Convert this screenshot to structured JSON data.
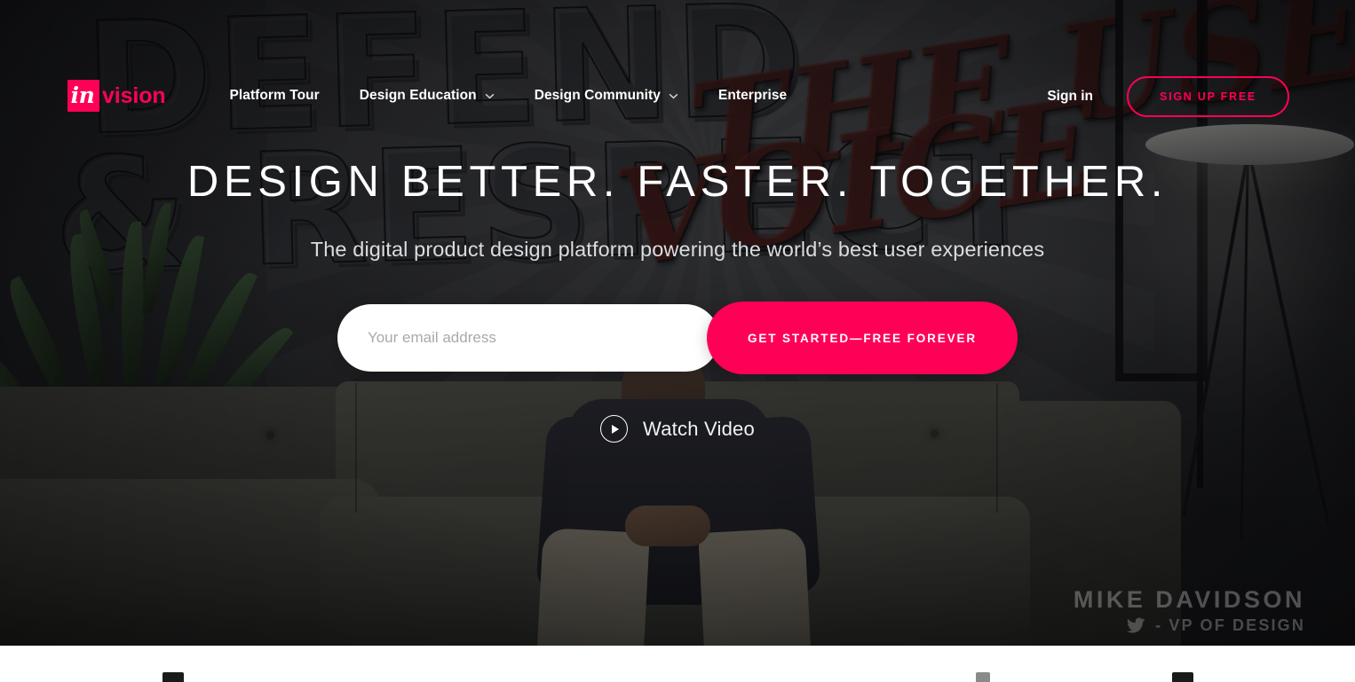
{
  "brand": {
    "name": "invision",
    "mark_text": "in",
    "word_text": "vision",
    "accent_color": "#ff0057"
  },
  "nav": {
    "items": [
      {
        "label": "Platform Tour",
        "has_dropdown": false
      },
      {
        "label": "Design Education",
        "has_dropdown": true,
        "icon": "chevron-down-icon"
      },
      {
        "label": "Design Community",
        "has_dropdown": true,
        "icon": "chevron-down-icon"
      },
      {
        "label": "Enterprise",
        "has_dropdown": false
      }
    ],
    "sign_in_label": "Sign in",
    "sign_up_label": "SIGN UP FREE"
  },
  "hero": {
    "headline": "DESIGN BETTER. FASTER. TOGETHER.",
    "subhead": "The digital product design platform powering the world’s best user experiences",
    "email": {
      "value": "",
      "placeholder": "Your email address"
    },
    "cta_label": "GET STARTED—FREE FOREVER",
    "watch_video_label": "Watch Video",
    "watch_video_icon": "play-circle-icon"
  },
  "video_caption": {
    "speaker_name": "MIKE DAVIDSON",
    "speaker_role": "- VP OF DESIGN",
    "social_icon": "twitter-bird-icon"
  },
  "background_art": {
    "mural_block_line1": "DEFEND",
    "mural_block_line2": "& RESPECT",
    "mural_script_line1": "THE USER’S",
    "mural_script_line2": "VOICE"
  }
}
